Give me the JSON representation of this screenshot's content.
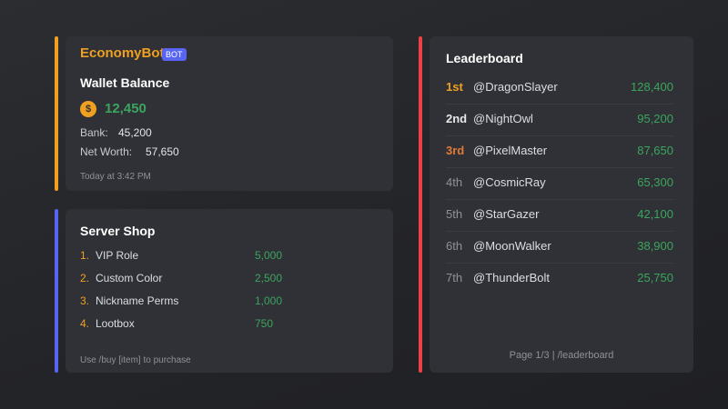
{
  "colors": {
    "wallet_accent": "#f0a020",
    "shop_accent": "#5865f2",
    "leaderboard_accent": "#ed4245",
    "positive_green": "#3ba55d",
    "gold": "#f0a020"
  },
  "wallet": {
    "bot_name": "EconomyBot",
    "bot_badge": "BOT",
    "title": "Wallet Balance",
    "coin_icon": "$",
    "balance": "12,450",
    "bank_label": "Bank:",
    "bank_value": "45,200",
    "networth_label": "Net Worth:",
    "networth_value": "57,650",
    "timestamp": "Today at 3:42 PM"
  },
  "shop": {
    "title": "Server Shop",
    "items": [
      {
        "num": "1.",
        "name": "VIP Role",
        "price": "5,000"
      },
      {
        "num": "2.",
        "name": "Custom Color",
        "price": "2,500"
      },
      {
        "num": "3.",
        "name": "Nickname Perms",
        "price": "1,000"
      },
      {
        "num": "4.",
        "name": "Lootbox",
        "price": "750"
      }
    ],
    "footer": "Use /buy [item] to purchase"
  },
  "leaderboard": {
    "title": "Leaderboard",
    "rows": [
      {
        "rank": "1st",
        "user": "@DragonSlayer",
        "score": "128,400"
      },
      {
        "rank": "2nd",
        "user": "@NightOwl",
        "score": "95,200"
      },
      {
        "rank": "3rd",
        "user": "@PixelMaster",
        "score": "87,650"
      },
      {
        "rank": "4th",
        "user": "@CosmicRay",
        "score": "65,300"
      },
      {
        "rank": "5th",
        "user": "@StarGazer",
        "score": "42,100"
      },
      {
        "rank": "6th",
        "user": "@MoonWalker",
        "score": "38,900"
      },
      {
        "rank": "7th",
        "user": "@ThunderBolt",
        "score": "25,750"
      }
    ],
    "footer": "Page 1/3 | /leaderboard"
  }
}
